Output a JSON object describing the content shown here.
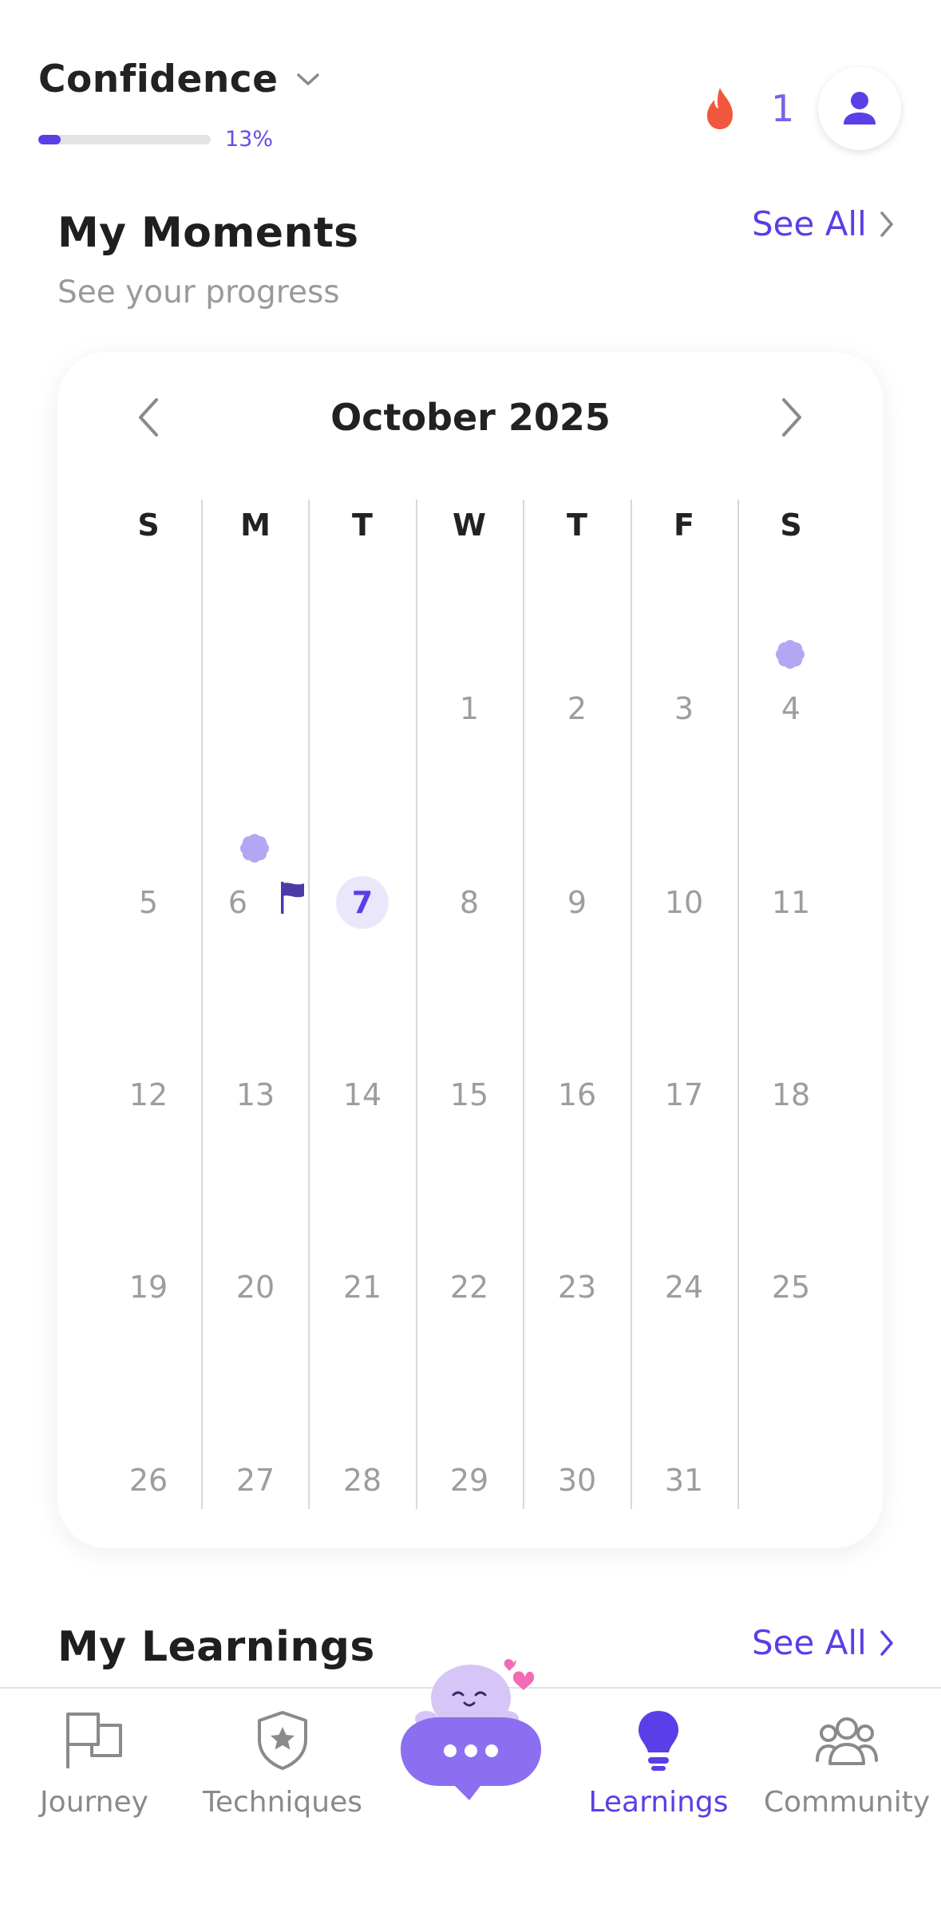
{
  "header": {
    "goal_title": "Confidence",
    "progress_percent_label": "13%",
    "progress_value": 0.13,
    "streak_count": "1",
    "icons": {
      "goal_dropdown": "chevron-down-icon",
      "streak": "flame-icon",
      "profile": "user-icon"
    }
  },
  "moments": {
    "title": "My Moments",
    "subtitle": "See your progress",
    "see_all_label": "See All"
  },
  "calendar": {
    "month_label": "October 2025",
    "weekdays": [
      "S",
      "M",
      "T",
      "W",
      "T",
      "F",
      "S"
    ],
    "weeks": [
      [
        "",
        "",
        "",
        "1",
        "2",
        "3",
        "4"
      ],
      [
        "5",
        "6",
        "7",
        "8",
        "9",
        "10",
        "11"
      ],
      [
        "12",
        "13",
        "14",
        "15",
        "16",
        "17",
        "18"
      ],
      [
        "19",
        "20",
        "21",
        "22",
        "23",
        "24",
        "25"
      ],
      [
        "26",
        "27",
        "28",
        "29",
        "30",
        "31",
        ""
      ]
    ],
    "today": "7",
    "moment_days": [
      "4",
      "6"
    ],
    "flag_day": "6",
    "icons": {
      "prev": "chevron-left-icon",
      "next": "chevron-right-icon",
      "moment": "flower-icon",
      "flag": "flag-icon"
    }
  },
  "learnings": {
    "title": "My Learnings",
    "see_all_label": "See All"
  },
  "bottom_nav": {
    "items": [
      {
        "label": "Journey",
        "icon": "flag-icon",
        "active": false
      },
      {
        "label": "Techniques",
        "icon": "shield-star-icon",
        "active": false
      },
      {
        "label": "",
        "icon": "chat-bubble-icon",
        "active": false
      },
      {
        "label": "Learnings",
        "icon": "lightbulb-icon",
        "active": true
      },
      {
        "label": "Community",
        "icon": "people-icon",
        "active": false
      }
    ]
  },
  "colors": {
    "accent": "#5a3ee8",
    "accent_light": "#ebe7fb",
    "moment_flower": "#b5a6f4",
    "flame": "#f0583e",
    "muted_text": "#9d9d9d"
  }
}
